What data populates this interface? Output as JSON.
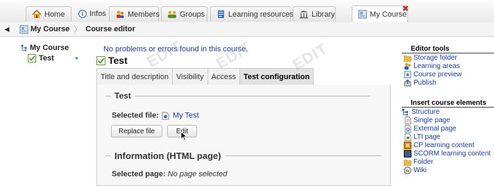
{
  "tabs": [
    {
      "label": "Home",
      "icon": "home-icon"
    },
    {
      "label": "Infos",
      "icon": "info-icon"
    },
    {
      "label": "Members",
      "icon": "members-icon"
    },
    {
      "label": "Groups",
      "icon": "groups-icon"
    },
    {
      "label": "Learning resources",
      "icon": "learning-resources-icon"
    },
    {
      "label": "Library",
      "icon": "library-icon"
    },
    {
      "label": "My Course",
      "icon": "course-icon",
      "close": "✖"
    }
  ],
  "breadcrumb": {
    "course": "My Course",
    "current": "Course editor"
  },
  "tree": {
    "root": "My Course",
    "child": "Test"
  },
  "main": {
    "message": "No problems or errors found in this course.",
    "title": "Test",
    "subtabs": [
      "Title and description",
      "Visibility",
      "Access",
      "Test configuration"
    ],
    "test_section": {
      "legend": "Test",
      "selected_file_label": "Selected file:",
      "selected_file": "My Test",
      "replace_button": "Replace file",
      "edit_button": "Edit"
    },
    "info_section": {
      "legend": "Information (HTML page)",
      "selected_page_label": "Selected page:",
      "selected_page_value": "No page selected"
    }
  },
  "sidebar": {
    "editor_tools_title": "Editor tools",
    "editor_tools": [
      "Storage folder",
      "Learning areas",
      "Course preview",
      "Publish"
    ],
    "insert_title": "Insert course elements",
    "insert_items": [
      "Structure",
      "Single page",
      "External page",
      "LTI page",
      "CP learning content",
      "SCORM learning content",
      "Folder",
      "Wiki"
    ]
  },
  "colors": {
    "link": "#1a3da0",
    "ok": "#33aa33",
    "accent": "#e8a000"
  }
}
